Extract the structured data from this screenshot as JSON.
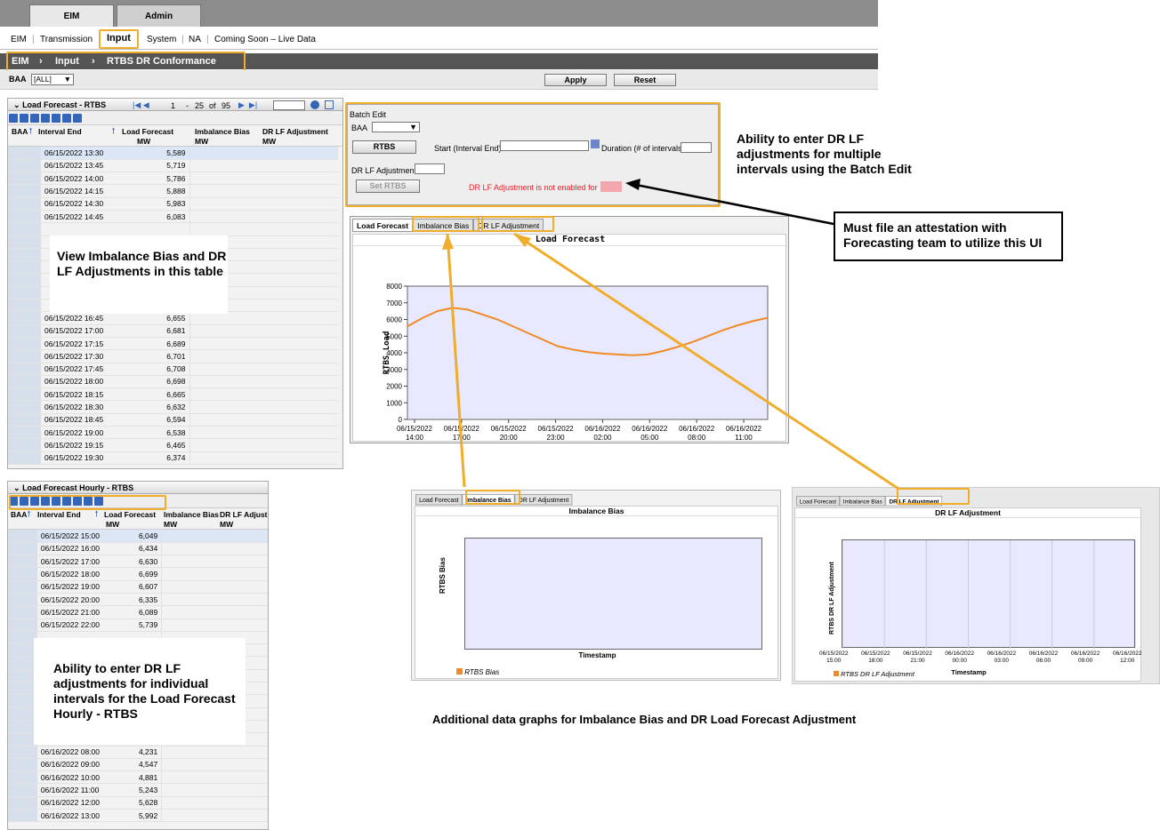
{
  "tabs": {
    "eim": "EIM",
    "admin": "Admin"
  },
  "nav": {
    "items": [
      "EIM",
      "Transmission",
      "Input",
      "System",
      "NA",
      "Coming Soon – Live Data"
    ]
  },
  "breadcrumb": {
    "a": "EIM",
    "b": "Input",
    "c": "RTBS DR Conformance"
  },
  "baa_filter": {
    "label": "BAA",
    "value": "[ALL]"
  },
  "buttons": {
    "apply": "Apply",
    "reset": "Reset"
  },
  "table1": {
    "title": "Load Forecast - RTBS",
    "pager": {
      "start": "1",
      "end": "25",
      "of": "of",
      "total": "95",
      "dash": "-"
    },
    "headers": {
      "baa": "BAA",
      "interval_end": "Interval End",
      "load_forecast": "Load Forecast",
      "imbalance_bias": "Imbalance Bias",
      "dr_lf": "DR LF Adjustment",
      "mw": "MW"
    },
    "rows": [
      [
        "06/15/2022 13:30",
        "5,589"
      ],
      [
        "06/15/2022 13:45",
        "5,719"
      ],
      [
        "06/15/2022 14:00",
        "5,786"
      ],
      [
        "06/15/2022 14:15",
        "5,888"
      ],
      [
        "06/15/2022 14:30",
        "5,983"
      ],
      [
        "06/15/2022 14:45",
        "6,083"
      ],
      [
        "",
        ""
      ],
      [
        "",
        ""
      ],
      [
        "",
        ""
      ],
      [
        "",
        ""
      ],
      [
        "",
        ""
      ],
      [
        "",
        ""
      ],
      [
        "",
        ""
      ],
      [
        "06/15/2022 16:45",
        "6,655"
      ],
      [
        "06/15/2022 17:00",
        "6,681"
      ],
      [
        "06/15/2022 17:15",
        "6,689"
      ],
      [
        "06/15/2022 17:30",
        "6,701"
      ],
      [
        "06/15/2022 17:45",
        "6,708"
      ],
      [
        "06/15/2022 18:00",
        "6,698"
      ],
      [
        "06/15/2022 18:15",
        "6,665"
      ],
      [
        "06/15/2022 18:30",
        "6,632"
      ],
      [
        "06/15/2022 18:45",
        "6,594"
      ],
      [
        "06/15/2022 19:00",
        "6,538"
      ],
      [
        "06/15/2022 19:15",
        "6,465"
      ],
      [
        "06/15/2022 19:30",
        "6,374"
      ]
    ]
  },
  "table2": {
    "title": "Load Forecast Hourly - RTBS",
    "headers": {
      "baa": "BAA",
      "interval_end": "Interval End",
      "load_forecast": "Load Forecast",
      "imbalance_bias": "Imbalance Bias",
      "dr_lf": "DR LF Adjust",
      "mw": "MW"
    },
    "rows": [
      [
        "06/15/2022 15:00",
        "6,049"
      ],
      [
        "06/15/2022 16:00",
        "6,434"
      ],
      [
        "06/15/2022 17:00",
        "6,630"
      ],
      [
        "06/15/2022 18:00",
        "6,699"
      ],
      [
        "06/15/2022 19:00",
        "6,607"
      ],
      [
        "06/15/2022 20:00",
        "6,335"
      ],
      [
        "06/15/2022 21:00",
        "6,089"
      ],
      [
        "06/15/2022 22:00",
        "5,739"
      ],
      [
        "",
        ""
      ],
      [
        "",
        ""
      ],
      [
        "",
        ""
      ],
      [
        "",
        ""
      ],
      [
        "",
        ""
      ],
      [
        "",
        ""
      ],
      [
        "",
        ""
      ],
      [
        "",
        ""
      ],
      [
        "",
        ""
      ],
      [
        "06/16/2022 08:00",
        "4,231"
      ],
      [
        "06/16/2022 09:00",
        "4,547"
      ],
      [
        "06/16/2022 10:00",
        "4,881"
      ],
      [
        "06/16/2022 11:00",
        "5,243"
      ],
      [
        "06/16/2022 12:00",
        "5,628"
      ],
      [
        "06/16/2022 13:00",
        "5,992"
      ]
    ]
  },
  "batch": {
    "title": "Batch Edit",
    "baa_label": "BAA",
    "rtbs_button": "RTBS",
    "start_label": "Start (Interval End)",
    "duration_label": "Duration (# of intervals)",
    "drlf_label": "DR LF Adjustment",
    "set_button": "Set RTBS",
    "warning": "DR LF Adjustment is not enabled for",
    "warning_color": "#e8202a"
  },
  "graph_tabs": {
    "load": "Load Forecast",
    "imb": "Imbalance Bias",
    "drlf": "DR LF Adjustment"
  },
  "chart_data": [
    {
      "type": "line",
      "title": "Load Forecast",
      "xlabel": "Timestamp",
      "ylabel": "RTBS Load",
      "ylim": [
        0,
        8000
      ],
      "yticks": [
        "0",
        "1000",
        "2000",
        "3000",
        "4000",
        "5000",
        "6000",
        "7000",
        "8000"
      ],
      "xticks": [
        "06/15/2022\n14:00",
        "06/15/2022\n17:00",
        "06/15/2022\n20:00",
        "06/15/2022\n23:00",
        "06/16/2022\n02:00",
        "06/16/2022\n05:00",
        "06/16/2022\n08:00",
        "06/16/2022\n11:00"
      ],
      "series": [
        {
          "name": "RTBS Load",
          "color": "#f08a24",
          "x": [
            0,
            1,
            2,
            3,
            4,
            5,
            6,
            7,
            8,
            9,
            10,
            11,
            12,
            13,
            14,
            15,
            16,
            17,
            18,
            19,
            20,
            21,
            22,
            23,
            24
          ],
          "values": [
            5589,
            6083,
            6500,
            6700,
            6600,
            6300,
            6000,
            5600,
            5200,
            4800,
            4400,
            4200,
            4050,
            3950,
            3900,
            3850,
            3900,
            4100,
            4350,
            4650,
            5000,
            5350,
            5650,
            5900,
            6100
          ]
        }
      ]
    },
    {
      "type": "line",
      "title": "Imbalance Bias",
      "xlabel": "Timestamp",
      "ylabel": "RTBS Bias",
      "series": [
        {
          "name": "RTBS Bias",
          "values": []
        }
      ]
    },
    {
      "type": "line",
      "title": "DR LF Adjustment",
      "xlabel": "Timestamp",
      "ylabel": "RTBS DR LF Adjustment",
      "xticks": [
        "06/15/2022\n15:00",
        "06/15/2022\n18:00",
        "06/15/2022\n21:00",
        "06/16/2022\n00:00",
        "06/16/2022\n03:00",
        "06/16/2022\n06:00",
        "06/16/2022\n09:00",
        "06/16/2022\n12:00"
      ],
      "series": [
        {
          "name": "RTBS DR LF Adjustment",
          "values": []
        }
      ]
    }
  ],
  "callouts": {
    "batch": "Ability to enter DR LF adjustments for multiple intervals using the Batch Edit",
    "attest": "Must file an attestation with Forecasting team to utilize this UI",
    "view": "View Imbalance Bias and DR LF Adjustments in this table",
    "individual": "Ability to enter DR LF adjustments for individual intervals for the Load Forecast Hourly - RTBS",
    "additional": "Additional data graphs for Imbalance Bias and DR Load Forecast Adjustment"
  },
  "accent": "#f0ad2b"
}
